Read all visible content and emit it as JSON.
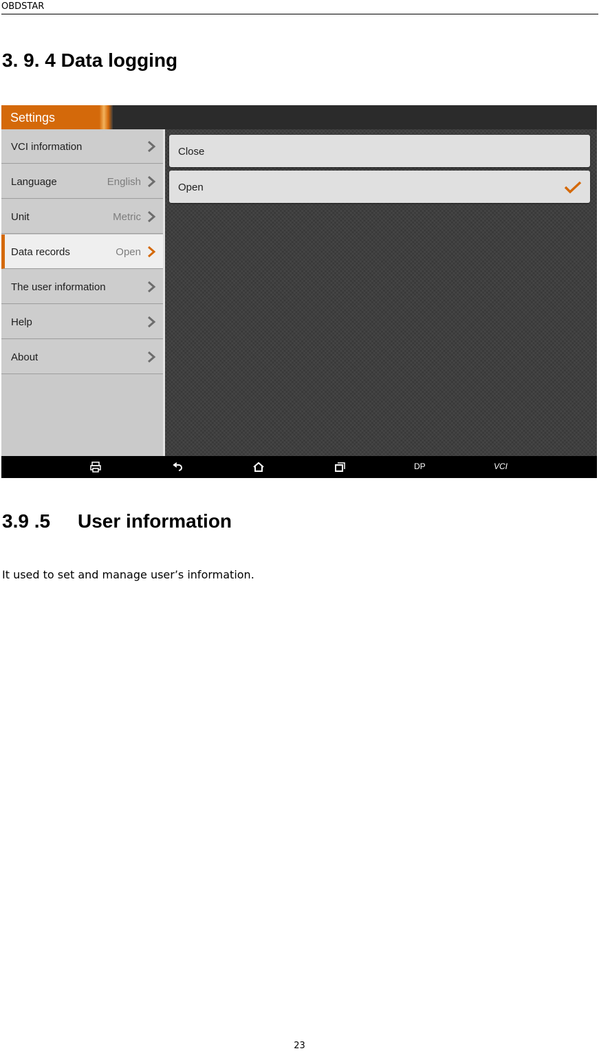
{
  "doc_header": "OBDSTAR",
  "section_title": "3. 9. 4 Data logging",
  "screenshot": {
    "title": "Settings",
    "sidebar": {
      "items": [
        {
          "label": "VCI information",
          "value": ""
        },
        {
          "label": "Language",
          "value": "English"
        },
        {
          "label": "Unit",
          "value": "Metric"
        },
        {
          "label": "Data records",
          "value": "Open"
        },
        {
          "label": "The user information",
          "value": ""
        },
        {
          "label": "Help",
          "value": ""
        },
        {
          "label": "About",
          "value": ""
        }
      ]
    },
    "options": [
      {
        "label": "Close",
        "selected": false
      },
      {
        "label": "Open",
        "selected": true
      }
    ],
    "navbar": {
      "icons": [
        "printer-icon",
        "back-icon",
        "home-icon",
        "recent-apps-icon"
      ],
      "dp_label": "DP",
      "vci_label": "VCI"
    },
    "colors": {
      "accent": "#d4690a"
    }
  },
  "subsection": {
    "number": "3.9 .5",
    "title": "User information"
  },
  "body_text": "It used to set and manage user’s information.",
  "page_number": "23"
}
